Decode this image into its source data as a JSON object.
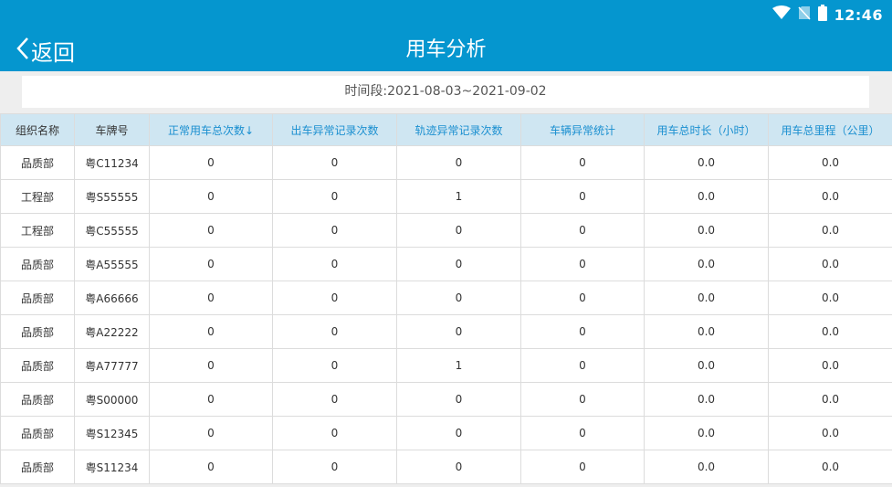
{
  "status": {
    "time": "12:46"
  },
  "header": {
    "back_label": "返回",
    "title": "用车分析"
  },
  "period": "时间段:2021-08-03~2021-09-02",
  "table": {
    "columns": [
      "组织名称",
      "车牌号",
      "正常用车总次数↓",
      "出车异常记录次数",
      "轨迹异常记录次数",
      "车辆异常统计",
      "用车总时长（小时）",
      "用车总里程（公里）"
    ],
    "rows": [
      [
        "品质部",
        "粤C11234",
        "0",
        "0",
        "0",
        "0",
        "0.0",
        "0.0"
      ],
      [
        "工程部",
        "粤S55555",
        "0",
        "0",
        "1",
        "0",
        "0.0",
        "0.0"
      ],
      [
        "工程部",
        "粤C55555",
        "0",
        "0",
        "0",
        "0",
        "0.0",
        "0.0"
      ],
      [
        "品质部",
        "粤A55555",
        "0",
        "0",
        "0",
        "0",
        "0.0",
        "0.0"
      ],
      [
        "品质部",
        "粤A66666",
        "0",
        "0",
        "0",
        "0",
        "0.0",
        "0.0"
      ],
      [
        "品质部",
        "粤A22222",
        "0",
        "0",
        "0",
        "0",
        "0.0",
        "0.0"
      ],
      [
        "品质部",
        "粤A77777",
        "0",
        "0",
        "1",
        "0",
        "0.0",
        "0.0"
      ],
      [
        "品质部",
        "粤S00000",
        "0",
        "0",
        "0",
        "0",
        "0.0",
        "0.0"
      ],
      [
        "品质部",
        "粤S12345",
        "0",
        "0",
        "0",
        "0",
        "0.0",
        "0.0"
      ],
      [
        "品质部",
        "粤S11234",
        "0",
        "0",
        "0",
        "0",
        "0.0",
        "0.0"
      ]
    ]
  },
  "colors": {
    "appbar": "#0596cf",
    "header_row": "#cfe6f2",
    "header_link": "#1a8fd0"
  }
}
